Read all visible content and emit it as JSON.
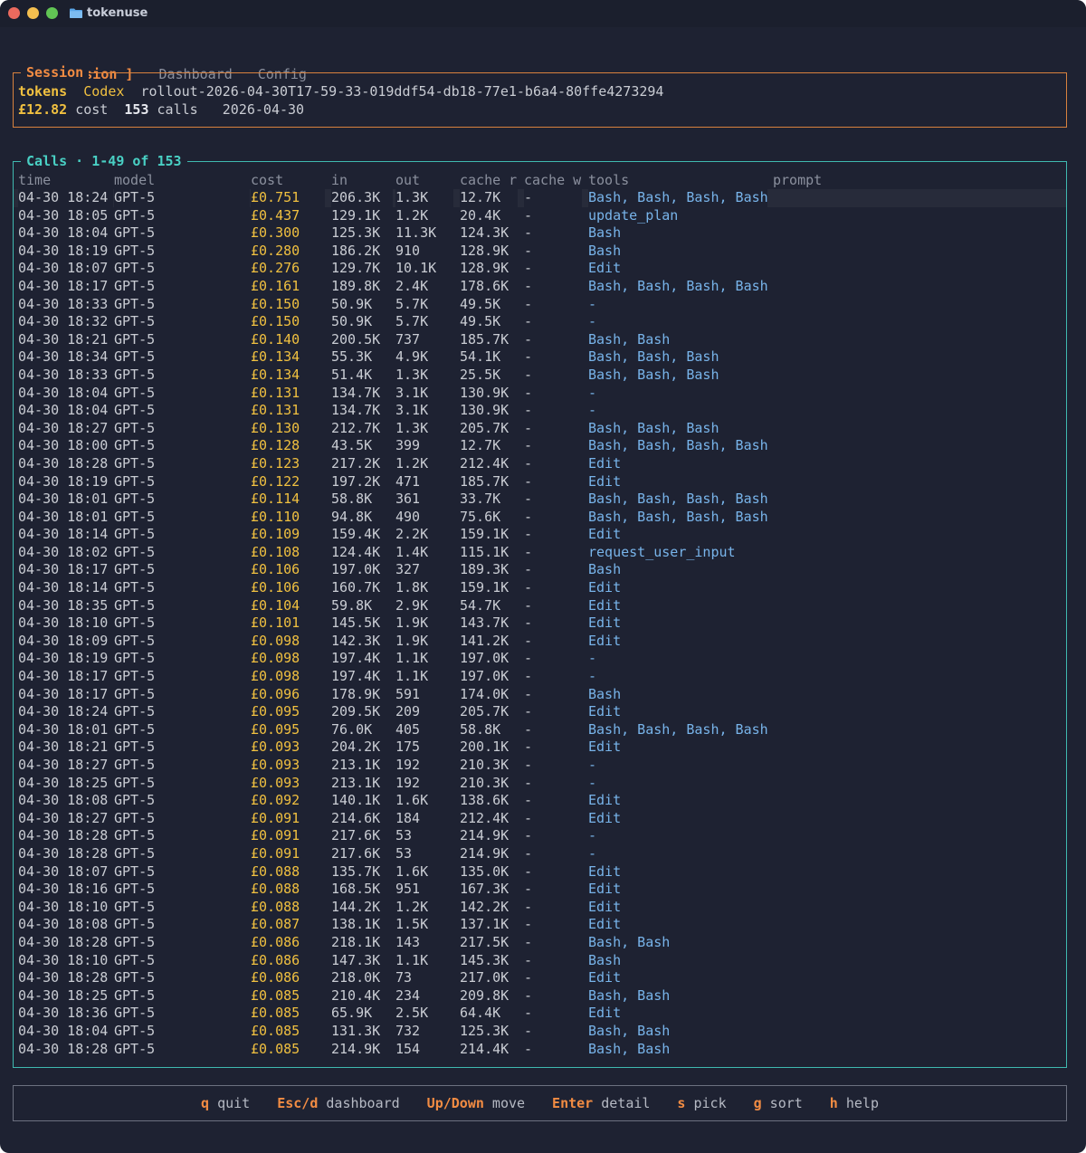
{
  "window": {
    "title": "tokenuse"
  },
  "tabs": [
    {
      "label": "[ Session ]",
      "active": true
    },
    {
      "label": "Dashboard",
      "active": false
    },
    {
      "label": "Config",
      "active": false
    }
  ],
  "session": {
    "title": "Session",
    "tokens_label": "tokens",
    "source": "Codex",
    "rollout_id": "rollout-2026-04-30T17-59-33-019ddf54-db18-77e1-b6a4-80ffe4273294",
    "cost": "£12.82",
    "cost_label": "cost",
    "calls": "153",
    "calls_label": "calls",
    "date": "2026-04-30"
  },
  "calls": {
    "title": "Calls · 1-49 of 153",
    "headers": [
      "time",
      "model",
      "cost",
      "in",
      "out",
      "cache r",
      "cache w",
      "tools",
      "prompt"
    ],
    "rows": [
      [
        "04-30 18:24",
        "GPT-5",
        "£0.751",
        "206.3K",
        "1.3K",
        "12.7K",
        "-",
        "Bash, Bash, Bash, Bash"
      ],
      [
        "04-30 18:05",
        "GPT-5",
        "£0.437",
        "129.1K",
        "1.2K",
        "20.4K",
        "-",
        "update_plan"
      ],
      [
        "04-30 18:04",
        "GPT-5",
        "£0.300",
        "125.3K",
        "11.3K",
        "124.3K",
        "-",
        "Bash"
      ],
      [
        "04-30 18:19",
        "GPT-5",
        "£0.280",
        "186.2K",
        "910",
        "128.9K",
        "-",
        "Bash"
      ],
      [
        "04-30 18:07",
        "GPT-5",
        "£0.276",
        "129.7K",
        "10.1K",
        "128.9K",
        "-",
        "Edit"
      ],
      [
        "04-30 18:17",
        "GPT-5",
        "£0.161",
        "189.8K",
        "2.4K",
        "178.6K",
        "-",
        "Bash, Bash, Bash, Bash"
      ],
      [
        "04-30 18:33",
        "GPT-5",
        "£0.150",
        "50.9K",
        "5.7K",
        "49.5K",
        "-",
        "-"
      ],
      [
        "04-30 18:32",
        "GPT-5",
        "£0.150",
        "50.9K",
        "5.7K",
        "49.5K",
        "-",
        "-"
      ],
      [
        "04-30 18:21",
        "GPT-5",
        "£0.140",
        "200.5K",
        "737",
        "185.7K",
        "-",
        "Bash, Bash"
      ],
      [
        "04-30 18:34",
        "GPT-5",
        "£0.134",
        "55.3K",
        "4.9K",
        "54.1K",
        "-",
        "Bash, Bash, Bash"
      ],
      [
        "04-30 18:33",
        "GPT-5",
        "£0.134",
        "51.4K",
        "1.3K",
        "25.5K",
        "-",
        "Bash, Bash, Bash"
      ],
      [
        "04-30 18:04",
        "GPT-5",
        "£0.131",
        "134.7K",
        "3.1K",
        "130.9K",
        "-",
        "-"
      ],
      [
        "04-30 18:04",
        "GPT-5",
        "£0.131",
        "134.7K",
        "3.1K",
        "130.9K",
        "-",
        "-"
      ],
      [
        "04-30 18:27",
        "GPT-5",
        "£0.130",
        "212.7K",
        "1.3K",
        "205.7K",
        "-",
        "Bash, Bash, Bash"
      ],
      [
        "04-30 18:00",
        "GPT-5",
        "£0.128",
        "43.5K",
        "399",
        "12.7K",
        "-",
        "Bash, Bash, Bash, Bash"
      ],
      [
        "04-30 18:28",
        "GPT-5",
        "£0.123",
        "217.2K",
        "1.2K",
        "212.4K",
        "-",
        "Edit"
      ],
      [
        "04-30 18:19",
        "GPT-5",
        "£0.122",
        "197.2K",
        "471",
        "185.7K",
        "-",
        "Edit"
      ],
      [
        "04-30 18:01",
        "GPT-5",
        "£0.114",
        "58.8K",
        "361",
        "33.7K",
        "-",
        "Bash, Bash, Bash, Bash"
      ],
      [
        "04-30 18:01",
        "GPT-5",
        "£0.110",
        "94.8K",
        "490",
        "75.6K",
        "-",
        "Bash, Bash, Bash, Bash"
      ],
      [
        "04-30 18:14",
        "GPT-5",
        "£0.109",
        "159.4K",
        "2.2K",
        "159.1K",
        "-",
        "Edit"
      ],
      [
        "04-30 18:02",
        "GPT-5",
        "£0.108",
        "124.4K",
        "1.4K",
        "115.1K",
        "-",
        "request_user_input"
      ],
      [
        "04-30 18:17",
        "GPT-5",
        "£0.106",
        "197.0K",
        "327",
        "189.3K",
        "-",
        "Bash"
      ],
      [
        "04-30 18:14",
        "GPT-5",
        "£0.106",
        "160.7K",
        "1.8K",
        "159.1K",
        "-",
        "Edit"
      ],
      [
        "04-30 18:35",
        "GPT-5",
        "£0.104",
        "59.8K",
        "2.9K",
        "54.7K",
        "-",
        "Edit"
      ],
      [
        "04-30 18:10",
        "GPT-5",
        "£0.101",
        "145.5K",
        "1.9K",
        "143.7K",
        "-",
        "Edit"
      ],
      [
        "04-30 18:09",
        "GPT-5",
        "£0.098",
        "142.3K",
        "1.9K",
        "141.2K",
        "-",
        "Edit"
      ],
      [
        "04-30 18:19",
        "GPT-5",
        "£0.098",
        "197.4K",
        "1.1K",
        "197.0K",
        "-",
        "-"
      ],
      [
        "04-30 18:17",
        "GPT-5",
        "£0.098",
        "197.4K",
        "1.1K",
        "197.0K",
        "-",
        "-"
      ],
      [
        "04-30 18:17",
        "GPT-5",
        "£0.096",
        "178.9K",
        "591",
        "174.0K",
        "-",
        "Bash"
      ],
      [
        "04-30 18:24",
        "GPT-5",
        "£0.095",
        "209.5K",
        "209",
        "205.7K",
        "-",
        "Edit"
      ],
      [
        "04-30 18:01",
        "GPT-5",
        "£0.095",
        "76.0K",
        "405",
        "58.8K",
        "-",
        "Bash, Bash, Bash, Bash"
      ],
      [
        "04-30 18:21",
        "GPT-5",
        "£0.093",
        "204.2K",
        "175",
        "200.1K",
        "-",
        "Edit"
      ],
      [
        "04-30 18:27",
        "GPT-5",
        "£0.093",
        "213.1K",
        "192",
        "210.3K",
        "-",
        "-"
      ],
      [
        "04-30 18:25",
        "GPT-5",
        "£0.093",
        "213.1K",
        "192",
        "210.3K",
        "-",
        "-"
      ],
      [
        "04-30 18:08",
        "GPT-5",
        "£0.092",
        "140.1K",
        "1.6K",
        "138.6K",
        "-",
        "Edit"
      ],
      [
        "04-30 18:27",
        "GPT-5",
        "£0.091",
        "214.6K",
        "184",
        "212.4K",
        "-",
        "Edit"
      ],
      [
        "04-30 18:28",
        "GPT-5",
        "£0.091",
        "217.6K",
        "53",
        "214.9K",
        "-",
        "-"
      ],
      [
        "04-30 18:28",
        "GPT-5",
        "£0.091",
        "217.6K",
        "53",
        "214.9K",
        "-",
        "-"
      ],
      [
        "04-30 18:07",
        "GPT-5",
        "£0.088",
        "135.7K",
        "1.6K",
        "135.0K",
        "-",
        "Edit"
      ],
      [
        "04-30 18:16",
        "GPT-5",
        "£0.088",
        "168.5K",
        "951",
        "167.3K",
        "-",
        "Edit"
      ],
      [
        "04-30 18:10",
        "GPT-5",
        "£0.088",
        "144.2K",
        "1.2K",
        "142.2K",
        "-",
        "Edit"
      ],
      [
        "04-30 18:08",
        "GPT-5",
        "£0.087",
        "138.1K",
        "1.5K",
        "137.1K",
        "-",
        "Edit"
      ],
      [
        "04-30 18:28",
        "GPT-5",
        "£0.086",
        "218.1K",
        "143",
        "217.5K",
        "-",
        "Bash, Bash"
      ],
      [
        "04-30 18:10",
        "GPT-5",
        "£0.086",
        "147.3K",
        "1.1K",
        "145.3K",
        "-",
        "Bash"
      ],
      [
        "04-30 18:28",
        "GPT-5",
        "£0.086",
        "218.0K",
        "73",
        "217.0K",
        "-",
        "Edit"
      ],
      [
        "04-30 18:25",
        "GPT-5",
        "£0.085",
        "210.4K",
        "234",
        "209.8K",
        "-",
        "Bash, Bash"
      ],
      [
        "04-30 18:36",
        "GPT-5",
        "£0.085",
        "65.9K",
        "2.5K",
        "64.4K",
        "-",
        "Edit"
      ],
      [
        "04-30 18:04",
        "GPT-5",
        "£0.085",
        "131.3K",
        "732",
        "125.3K",
        "-",
        "Bash, Bash"
      ],
      [
        "04-30 18:28",
        "GPT-5",
        "£0.085",
        "214.9K",
        "154",
        "214.4K",
        "-",
        "Bash, Bash"
      ]
    ]
  },
  "footer": {
    "keys": [
      {
        "key": "q",
        "desc": "quit"
      },
      {
        "key": "Esc/d",
        "desc": "dashboard"
      },
      {
        "key": "Up/Down",
        "desc": "move"
      },
      {
        "key": "Enter",
        "desc": "detail"
      },
      {
        "key": "s",
        "desc": "pick"
      },
      {
        "key": "g",
        "desc": "sort"
      },
      {
        "key": "h",
        "desc": "help"
      }
    ]
  },
  "colors": {
    "accent": "#f28c43",
    "cost": "#f0c040",
    "calls_border": "#3fb9b0",
    "tools": "#78b4ea",
    "background": "#1e2232"
  }
}
